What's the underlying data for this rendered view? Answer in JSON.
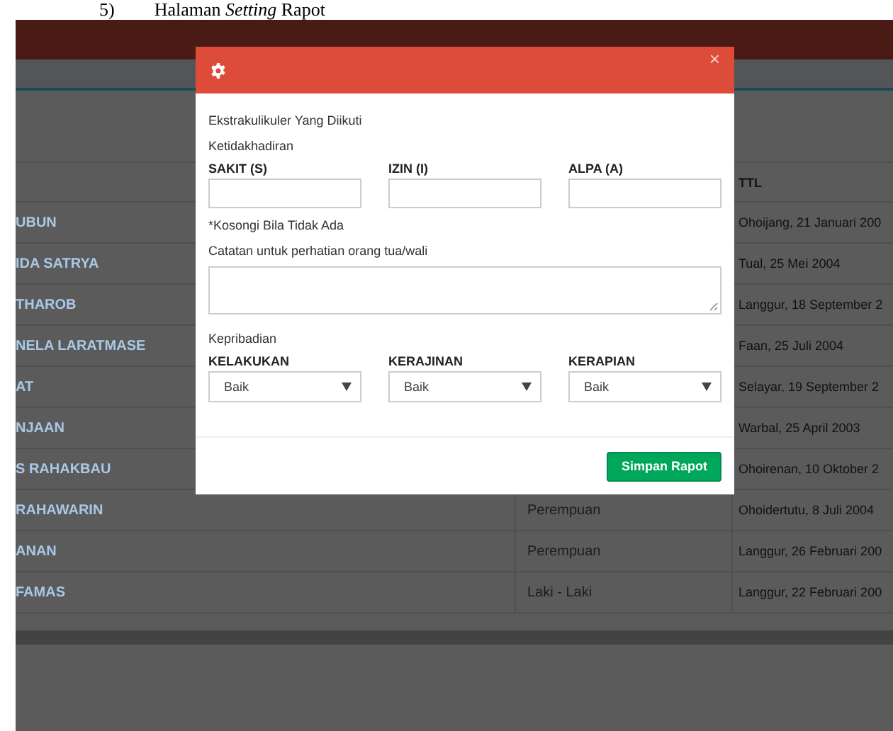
{
  "caption": {
    "number": "5)",
    "text": "Halaman *Setting* Rapot"
  },
  "table": {
    "columns": [
      {
        "label": "TTL"
      }
    ],
    "rows": [
      {
        "name": "UBUN",
        "ttl": "Ohoijang, 21 Januari 200"
      },
      {
        "name": "IDA SATRYA",
        "ttl": "Tual, 25 Mei 2004"
      },
      {
        "name": "THAROB",
        "ttl": "Langgur, 18 September 2"
      },
      {
        "name": "NELA LARATMASE",
        "ttl": "Faan, 25 Juli 2004"
      },
      {
        "name": "AT",
        "ttl": "Selayar, 19 September 2"
      },
      {
        "name": "NJAAN",
        "ttl": "Warbal, 25 April 2003"
      },
      {
        "name": "S RAHAKBAU",
        "ttl": "Ohoirenan, 10 Oktober 2"
      },
      {
        "name": "RAHAWARIN",
        "gender": "Perempuan",
        "ttl": "Ohoidertutu, 8 Juli 2004"
      },
      {
        "name": "ANAN",
        "gender": "Perempuan",
        "ttl": "Langgur, 26 Februari 200"
      },
      {
        "name": "FAMAS",
        "gender": "Laki - Laki",
        "ttl": "Langgur, 22 Februari 200"
      }
    ]
  },
  "modal": {
    "close": "×",
    "extracurricular_label": "Ekstrakulikuler Yang Diikuti",
    "absence_label": "Ketidakhadiran",
    "absence_fields": [
      {
        "label": "SAKIT (S)"
      },
      {
        "label": "IZIN (I)"
      },
      {
        "label": "ALPA (A)"
      }
    ],
    "note": "*Kosongi Bila Tidak Ada",
    "remarks_label": "Catatan untuk perhatian orang tua/wali",
    "personality_label": "Kepribadian",
    "personality_fields": [
      {
        "label": "KELAKUKAN",
        "value": "Baik"
      },
      {
        "label": "KERAJINAN",
        "value": "Baik"
      },
      {
        "label": "KERAPIAN",
        "value": "Baik"
      }
    ],
    "save_button": "Simpan Rapot"
  }
}
